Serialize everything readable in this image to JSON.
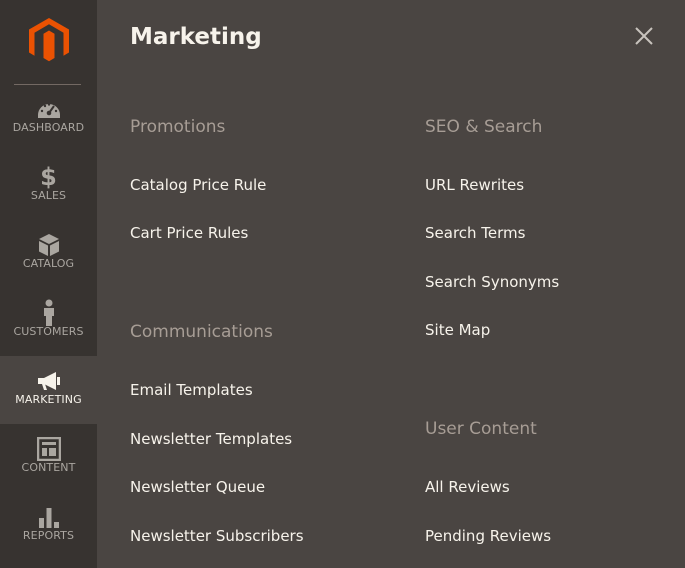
{
  "sidebar": {
    "logo_icon": "magento-logo",
    "brand_color": "#eb5202",
    "items": [
      {
        "label": "DASHBOARD",
        "icon": "speedometer-icon"
      },
      {
        "label": "SALES",
        "icon": "dollar-icon"
      },
      {
        "label": "CATALOG",
        "icon": "cube-icon"
      },
      {
        "label": "CUSTOMERS",
        "icon": "person-icon"
      },
      {
        "label": "MARKETING",
        "icon": "megaphone-icon",
        "active": true
      },
      {
        "label": "CONTENT",
        "icon": "layout-icon"
      },
      {
        "label": "REPORTS",
        "icon": "bar-chart-icon"
      }
    ]
  },
  "panel": {
    "title": "Marketing",
    "close_icon": "close-icon",
    "sections": [
      {
        "title": "Promotions",
        "items": [
          "Catalog Price Rule",
          "Cart Price Rules"
        ]
      },
      {
        "title": "Communications",
        "items": [
          "Email Templates",
          "Newsletter Templates",
          "Newsletter Queue",
          "Newsletter Subscribers"
        ]
      },
      {
        "title": "SEO & Search",
        "items": [
          "URL Rewrites",
          "Search Terms",
          "Search Synonyms",
          "Site Map"
        ]
      },
      {
        "title": "User Content",
        "items": [
          "All Reviews",
          "Pending Reviews"
        ]
      }
    ]
  },
  "colors": {
    "sidebar_bg": "#373330",
    "panel_bg": "#4a4542",
    "text": "#f7f3eb",
    "section_title": "#a79d95"
  }
}
